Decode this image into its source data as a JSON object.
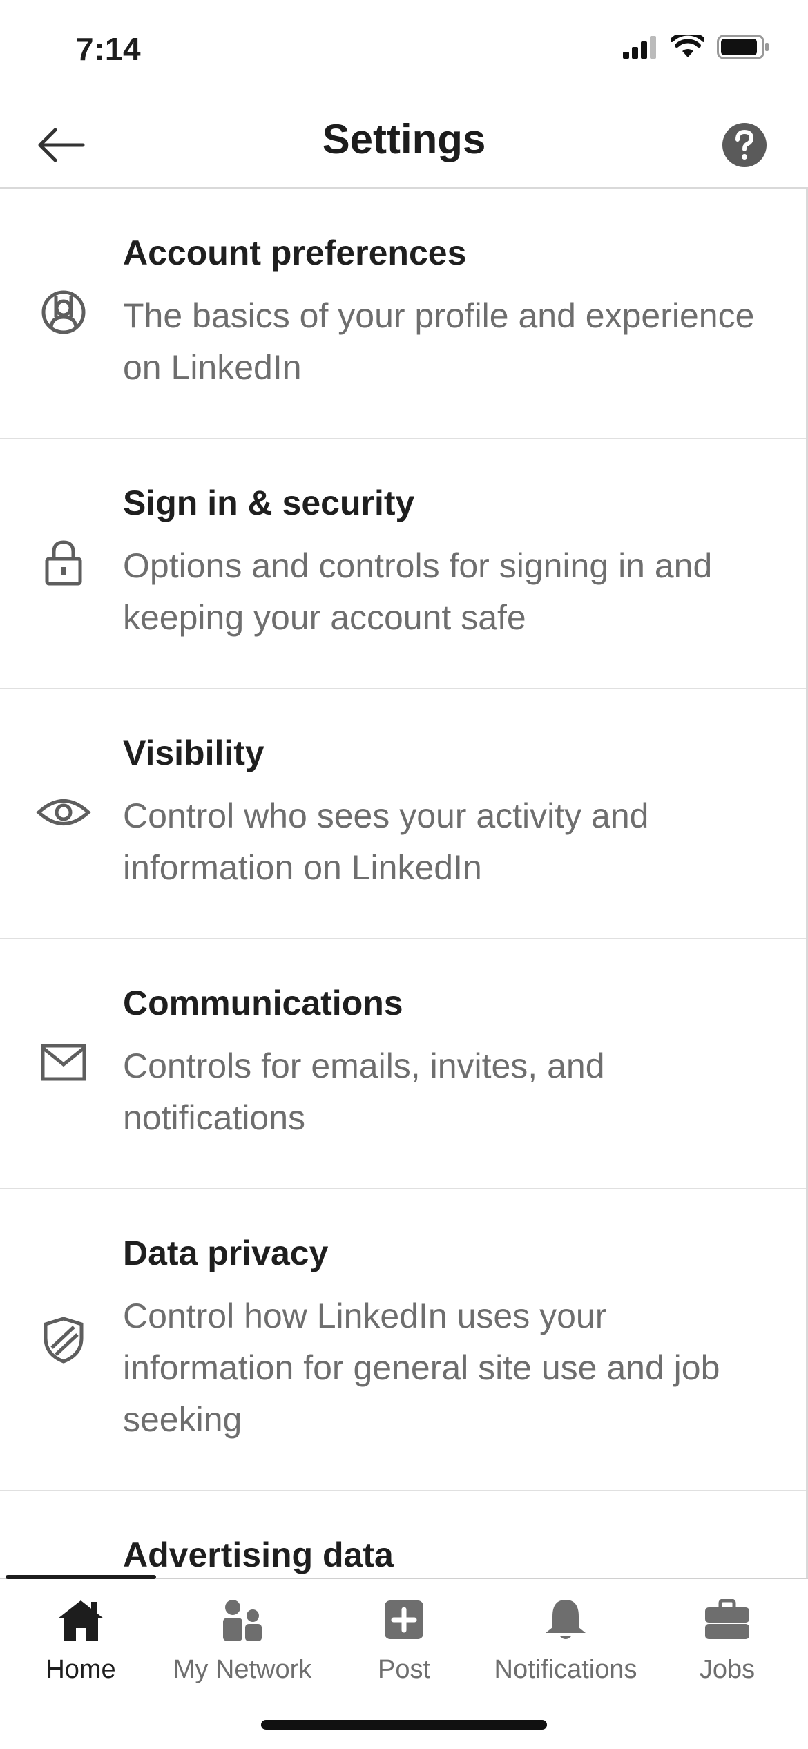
{
  "status_bar": {
    "time": "7:14"
  },
  "header": {
    "title": "Settings"
  },
  "settings": [
    {
      "icon": "account-icon",
      "title": "Account preferences",
      "description": "The basics of your profile and experience on LinkedIn"
    },
    {
      "icon": "lock-icon",
      "title": "Sign in & security",
      "description": "Options and controls for signing in and keeping your account safe"
    },
    {
      "icon": "eye-icon",
      "title": "Visibility",
      "description": "Control who sees your activity and information on LinkedIn"
    },
    {
      "icon": "envelope-icon",
      "title": "Communications",
      "description": "Controls for emails, invites, and notifications"
    },
    {
      "icon": "shield-icon",
      "title": "Data privacy",
      "description": "Control how LinkedIn uses your information for general site use and job seeking"
    },
    {
      "icon": "",
      "title": "Advertising data",
      "description": ""
    }
  ],
  "bottom_nav": {
    "active": "Home",
    "items": [
      {
        "label": "Home",
        "icon": "home-icon"
      },
      {
        "label": "My Network",
        "icon": "network-icon"
      },
      {
        "label": "Post",
        "icon": "post-icon"
      },
      {
        "label": "Notifications",
        "icon": "bell-icon"
      },
      {
        "label": "Jobs",
        "icon": "briefcase-icon"
      }
    ]
  },
  "colors": {
    "text_primary": "#1d1d1d",
    "text_secondary": "#6e6e6e",
    "icon_gray": "#5e5e5e",
    "divider": "#e0e0e0"
  }
}
